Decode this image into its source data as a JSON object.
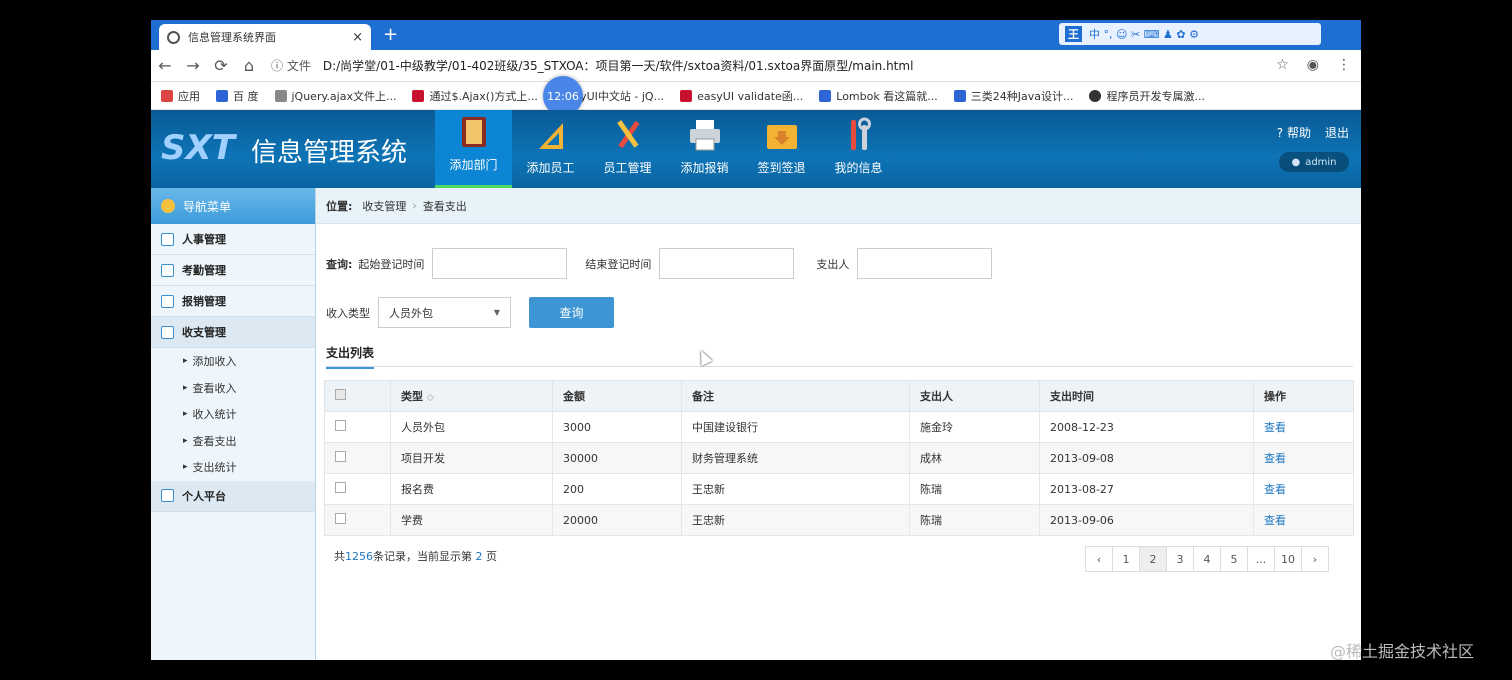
{
  "browser": {
    "tab_title": "信息管理系统界面",
    "tab_close": "×",
    "new_tab": "+",
    "ime_label": "王",
    "ime_text": "中 °, ☺ ✂ ⌨ ♟ ✿ ⚙",
    "info_label": "文件",
    "url": "D:/尚学堂/01-中级教学/01-402班级/35_STXOA：项目第一天/软件/sxtoa资料/01.sxtoa界面原型/main.html",
    "time": "12:06",
    "bookmarks": [
      {
        "label": "应用",
        "color": "#d44"
      },
      {
        "label": "百 度",
        "color": "#2d64d8"
      },
      {
        "label": "jQuery.ajax文件上...",
        "color": "#888"
      },
      {
        "label": "通过$.Ajax()方式上...",
        "color": "#c8102e"
      },
      {
        "label": ".syUI中文站 - jQ...",
        "color": "#4a86e8"
      },
      {
        "label": "easyUI validate函...",
        "color": "#c8102e"
      },
      {
        "label": "Lombok 看这篇就...",
        "color": "#2d64d8"
      },
      {
        "label": "三类24种Java设计...",
        "color": "#2d64d8"
      },
      {
        "label": "程序员开发专属激...",
        "color": "#333"
      }
    ]
  },
  "header": {
    "logo": "SXT",
    "title": "信息管理系统",
    "modules": [
      {
        "label": "添加部门",
        "icon": "book-icon",
        "active": true
      },
      {
        "label": "添加员工",
        "icon": "ruler-icon",
        "active": false
      },
      {
        "label": "员工管理",
        "icon": "tools-icon",
        "active": false
      },
      {
        "label": "添加报销",
        "icon": "printer-icon",
        "active": false
      },
      {
        "label": "签到签退",
        "icon": "folder-icon",
        "active": false
      },
      {
        "label": "我的信息",
        "icon": "wrench-icon",
        "active": false
      }
    ],
    "help": "帮助",
    "logout": "退出",
    "user": "admin"
  },
  "sidebar": {
    "nav_title": "导航菜单",
    "groups": [
      {
        "label": "人事管理"
      },
      {
        "label": "考勤管理"
      },
      {
        "label": "报销管理"
      },
      {
        "label": "收支管理"
      }
    ],
    "subitems": [
      "添加收入",
      "查看收入",
      "收入统计",
      "查看支出",
      "支出统计"
    ],
    "last_group": "个人平台"
  },
  "main": {
    "crumb_label": "位置:",
    "crumb_1": "收支管理",
    "crumb_2": "查看支出",
    "query_label": "查询:",
    "start_label": "起始登记时间",
    "end_label": "结束登记时间",
    "payer_label": "支出人",
    "income_type_label": "收入类型",
    "income_type_value": "人员外包",
    "query_button": "查询",
    "list_title": "支出列表",
    "columns": [
      "类型",
      "金额",
      "备注",
      "支出人",
      "支出时间",
      "操作"
    ],
    "sort_mark": "◇",
    "rows": [
      {
        "type": "人员外包",
        "amount": "3000",
        "note": "中国建设银行",
        "payer": "施金玲",
        "time": "2008-12-23",
        "op": "查看"
      },
      {
        "type": "项目开发",
        "amount": "30000",
        "note": "财务管理系统",
        "payer": "成林",
        "time": "2013-09-08",
        "op": "查看"
      },
      {
        "type": "报名费",
        "amount": "200",
        "note": "王忠新",
        "payer": "陈瑞",
        "time": "2013-08-27",
        "op": "查看"
      },
      {
        "type": "学费",
        "amount": "20000",
        "note": "王忠新",
        "payer": "陈瑞",
        "time": "2013-09-06",
        "op": "查看"
      }
    ],
    "page_prefix": "共",
    "total": "1256",
    "page_mid": "条记录，当前显示第",
    "current_page": "2",
    "page_suffix": "页",
    "pages": [
      "‹",
      "1",
      "2",
      "3",
      "4",
      "5",
      "...",
      "10",
      "›"
    ]
  },
  "watermark": "@稀土掘金技术社区"
}
